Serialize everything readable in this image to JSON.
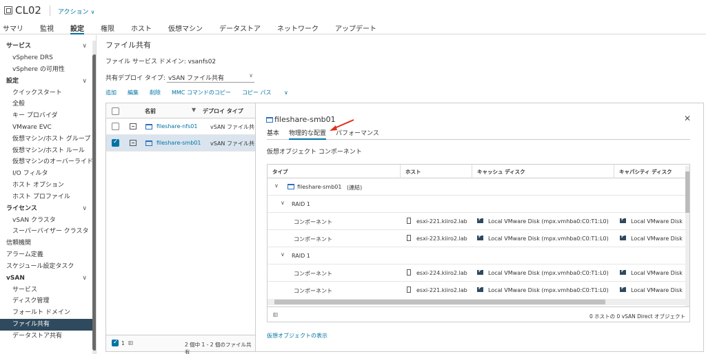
{
  "header": {
    "title": "CL02",
    "actions_label": "アクション",
    "tabs": [
      "サマリ",
      "監視",
      "設定",
      "権限",
      "ホスト",
      "仮想マシン",
      "データストア",
      "ネットワーク",
      "アップデート"
    ],
    "active_tab": "設定"
  },
  "sidebar": {
    "sections": [
      {
        "label": "サービス",
        "items": [
          "vSphere DRS",
          "vSphere の可用性"
        ]
      },
      {
        "label": "設定",
        "items": [
          "クイックスタート",
          "全般",
          "キー プロバイダ",
          "VMware EVC",
          "仮想マシン/ホスト グループ",
          "仮想マシン/ホスト ルール",
          "仮想マシンのオーバーライド",
          "I/O フィルタ",
          "ホスト オプション",
          "ホスト プロファイル"
        ]
      },
      {
        "label": "ライセンス",
        "items": [
          "vSAN クラスタ",
          "スーパーバイザー クラスタ"
        ]
      },
      {
        "label": "",
        "items_top": [
          "信頼機関",
          "アラーム定義",
          "スケジュール設定タスク"
        ]
      },
      {
        "label": "vSAN",
        "items": [
          "サービス",
          "ディスク管理",
          "フォールト ドメイン",
          "ファイル共有",
          "データストア共有"
        ]
      }
    ],
    "selected": "ファイル共有"
  },
  "main": {
    "title": "ファイル共有",
    "domain_text": "ファイル サービス ドメイン: vsanfs02",
    "share_type_label": "共有デプロイ タイプ:",
    "share_type_value": "vSAN ファイル共有",
    "toolbar": [
      "追加",
      "編集",
      "削除",
      "MMC コマンドのコピー",
      "コピー パス"
    ],
    "table": {
      "headers": [
        "名前",
        "デプロイ タイプ"
      ],
      "rows": [
        {
          "name": "fileshare-nfs01",
          "type": "vSAN ファイル共",
          "selected": false
        },
        {
          "name": "fileshare-smb01",
          "type": "vSAN ファイル共",
          "selected": true
        }
      ],
      "footer_count": "1",
      "footer_text": "2 個中 1 - 2 個のファイル共有"
    }
  },
  "detail": {
    "title": "fileshare-smb01",
    "tabs": [
      "基本",
      "物理的な配置",
      "パフォーマンス"
    ],
    "active_tab": "物理的な配置",
    "subtitle": "仮想オブジェクト コンポーネント",
    "grid": {
      "headers": [
        "タイプ",
        "ホスト",
        "キャッシュ ディスク",
        "キャパシティ ディスク"
      ],
      "root": "fileshare-smb01",
      "root_status": "(連結)",
      "rows": [
        {
          "kind": "raid",
          "label": "RAID 1"
        },
        {
          "kind": "comp",
          "label": "コンポーネント",
          "host": "esxi-221.kiiro2.lab",
          "cache": "Local VMware Disk (mpx.vmhba0:C0:T1:L0)",
          "capacity": "Local VMware Disk"
        },
        {
          "kind": "comp",
          "label": "コンポーネント",
          "host": "esxi-223.kiiro2.lab",
          "cache": "Local VMware Disk (mpx.vmhba0:C0:T1:L0)",
          "capacity": "Local VMware Disk"
        },
        {
          "kind": "raid",
          "label": "RAID 1"
        },
        {
          "kind": "comp",
          "label": "コンポーネント",
          "host": "esxi-224.kiiro2.lab",
          "cache": "Local VMware Disk (mpx.vmhba0:C0:T1:L0)",
          "capacity": "Local VMware Disk"
        },
        {
          "kind": "comp",
          "label": "コンポーネント",
          "host": "esxi-221.kiiro2.lab",
          "cache": "Local VMware Disk (mpx.vmhba0:C0:T1:L0)",
          "capacity": "Local VMware Disk"
        }
      ],
      "footer_text": "0 ホストの 0 vSAN Direct オブジェクト"
    },
    "bottom_link": "仮想オブジェクトの表示"
  },
  "colors": {
    "accent": "#0072a3",
    "selected_nav": "#2f4a5e",
    "selected_row": "#d9e4ee",
    "arrow": "#e0301e"
  }
}
